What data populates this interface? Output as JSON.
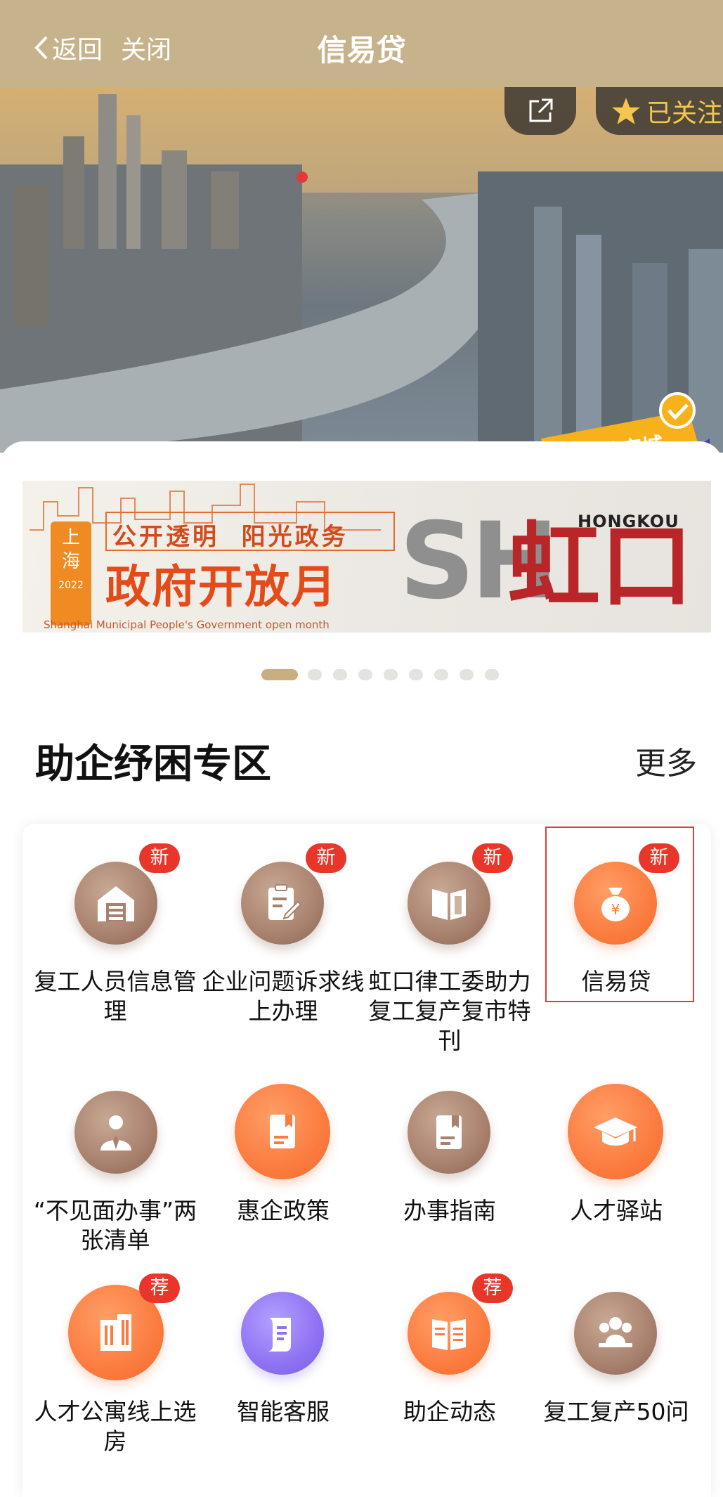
{
  "topbar": {
    "back_label": "返回",
    "close_label": "关闭",
    "title": "信易贷"
  },
  "hero": {
    "follow_label": "已关注",
    "points_mall_label": "积分商城"
  },
  "banner": {
    "province": "上\n海",
    "year": "2022",
    "slogan": "公开透明  阳光政务",
    "headline": "政府开放月",
    "subtitle": "Shanghai Municipal People's Government open month",
    "sh": "SH",
    "district_cn": "虹口",
    "district_en": "HONGKOU"
  },
  "carousel": {
    "total": 9,
    "active_index": 0
  },
  "section": {
    "title": "助企纾困专区",
    "more_label": "更多"
  },
  "items": [
    {
      "name": "复工人员信息管理",
      "tag": "新",
      "icon": "warehouse-icon",
      "color": "brown"
    },
    {
      "name": "企业问题诉求线上办理",
      "tag": "新",
      "icon": "clipboard-edit-icon",
      "color": "brown"
    },
    {
      "name": "虹口律工委助力复工复产复市特刊",
      "tag": "新",
      "icon": "open-book-icon",
      "color": "brown"
    },
    {
      "name": "信易贷",
      "tag": "新",
      "icon": "money-bag-icon",
      "color": "orange"
    },
    {
      "name": "“不见面办事”两张清单",
      "tag": "",
      "icon": "person-suit-icon",
      "color": "brown"
    },
    {
      "name": "惠企政策",
      "tag": "",
      "icon": "document-bookmark-icon",
      "color": "orange"
    },
    {
      "name": "办事指南",
      "tag": "",
      "icon": "document-bookmark-icon",
      "color": "brown"
    },
    {
      "name": "人才驿站",
      "tag": "",
      "icon": "graduation-cap-icon",
      "color": "orange"
    },
    {
      "name": "人才公寓线上选房",
      "tag": "荐",
      "icon": "building-icon",
      "color": "orange"
    },
    {
      "name": "智能客服",
      "tag": "",
      "icon": "scroll-icon",
      "color": "purple"
    },
    {
      "name": "助企动态",
      "tag": "荐",
      "icon": "newspaper-icon",
      "color": "orange"
    },
    {
      "name": "复工复产50问",
      "tag": "",
      "icon": "people-group-icon",
      "color": "brown"
    }
  ]
}
